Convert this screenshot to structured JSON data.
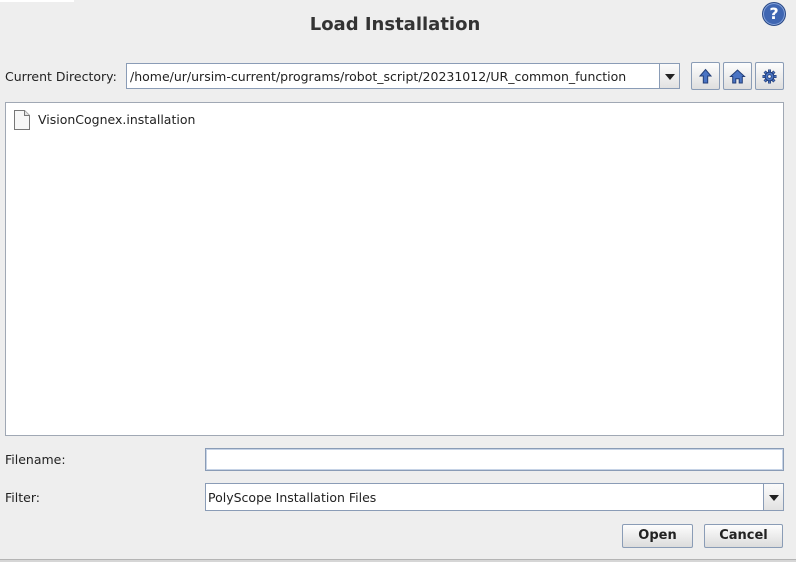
{
  "dialog": {
    "title": "Load Installation",
    "help_label": "?"
  },
  "directory": {
    "label": "Current Directory:",
    "path": "/home/ur/ursim-current/programs/robot_script/20231012/UR_common_function",
    "buttons": [
      "up-folder-icon",
      "home-icon",
      "gear-icon"
    ]
  },
  "files": [
    {
      "name": "VisionCognex.installation",
      "icon": "file-icon"
    }
  ],
  "filename": {
    "label": "Filename:",
    "value": ""
  },
  "filter": {
    "label": "Filter:",
    "selected": "PolyScope Installation Files"
  },
  "actions": {
    "open_label": "Open",
    "cancel_label": "Cancel"
  },
  "colors": {
    "accent": "#3f66b2",
    "border": "#8a9cb6",
    "background": "#eeeeee"
  }
}
